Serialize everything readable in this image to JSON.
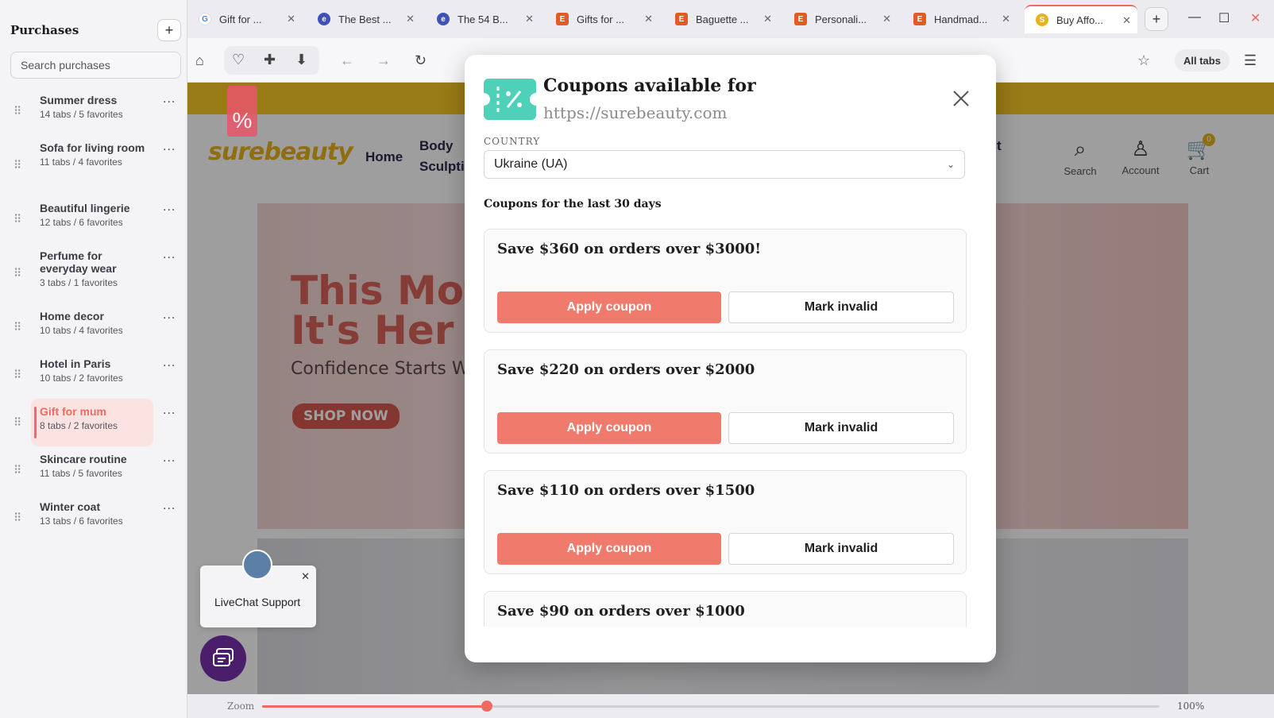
{
  "sidebar": {
    "title": "Purchases",
    "add_label": "+",
    "search_placeholder": "Search purchases",
    "items": [
      {
        "name": "Summer dress",
        "meta": "14 tabs / 5 favorites"
      },
      {
        "name": "Sofa for living room",
        "meta": "11 tabs / 4 favorites"
      },
      {
        "name": "Beautiful lingerie",
        "meta": "12 tabs / 6 favorites"
      },
      {
        "name": "Perfume for everyday wear",
        "meta": "3 tabs / 1 favorites"
      },
      {
        "name": "Home decor",
        "meta": "10 tabs / 4 favorites"
      },
      {
        "name": "Hotel in Paris",
        "meta": "10 tabs / 2 favorites"
      },
      {
        "name": "Gift for mum",
        "meta": "8 tabs / 2 favorites",
        "active": true
      },
      {
        "name": "Skincare routine",
        "meta": "11 tabs / 5 favorites"
      },
      {
        "name": "Winter coat",
        "meta": "13 tabs / 6 favorites"
      }
    ],
    "more_label": "...",
    "drag_label": "⠿"
  },
  "tabs": [
    {
      "title": "Gift for ...",
      "icon": "google-icon",
      "color": "#ffffff"
    },
    {
      "title": "The Best ...",
      "icon": "site-icon",
      "color": "#3f51b5"
    },
    {
      "title": "The 54 B...",
      "icon": "site-icon",
      "color": "#3f51b5"
    },
    {
      "title": "Gifts for ...",
      "icon": "etsy-icon",
      "color": "#e05c24"
    },
    {
      "title": "Baguette ...",
      "icon": "etsy-icon",
      "color": "#e05c24"
    },
    {
      "title": "Personali...",
      "icon": "etsy-icon",
      "color": "#e05c24"
    },
    {
      "title": "Handmad...",
      "icon": "etsy-icon",
      "color": "#e05c24"
    },
    {
      "title": "Buy Affo...",
      "icon": "surebeauty-icon",
      "color": "#e8b21b",
      "active": true
    }
  ],
  "toolbar": {
    "all_tabs_label": "All tabs"
  },
  "page": {
    "logo_text": "surebeauty",
    "nav": {
      "home": "Home",
      "body": "Body",
      "sculpt": "Sculpti",
      "contact": "ntact"
    },
    "header_icons": {
      "search": "Search",
      "account": "Account",
      "cart": "Cart",
      "cart_count": "0"
    },
    "hero": {
      "line1": "This Mot",
      "line2": "It's Her T",
      "sub": "Confidence Starts W",
      "cta": "SHOP NOW"
    },
    "livechat": "LiveChat Support"
  },
  "zoom": {
    "label": "Zoom",
    "value": "100%",
    "level": 0.25
  },
  "modal": {
    "title": "Coupons available for",
    "url": "https://surebeauty.com",
    "country_label": "COUNTRY",
    "country_value": "Ukraine (UA)",
    "section_title": "Coupons for the last 30 days",
    "apply_label": "Apply coupon",
    "invalid_label": "Mark invalid",
    "coupons": [
      {
        "title": "Save $360 on orders over $3000!"
      },
      {
        "title": "Save $220 on orders over $2000"
      },
      {
        "title": "Save $110 on orders over $1500"
      },
      {
        "title": "Save $90 on orders over $1000"
      }
    ]
  },
  "colors": {
    "accent": "#ef6b62",
    "coupon_button": "#f07a6c",
    "brand_teal": "#4fd1b9",
    "promo_yellow": "#f6c624"
  }
}
